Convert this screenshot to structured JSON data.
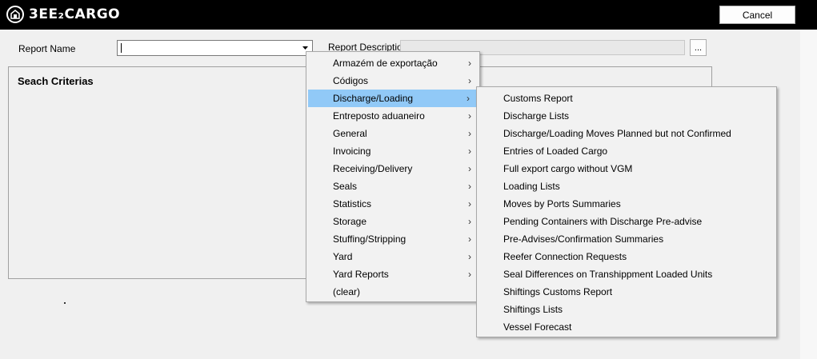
{
  "app": {
    "logo_text": "3EE₂CARGO"
  },
  "header": {
    "cancel_label": "Cancel"
  },
  "form": {
    "report_name_label": "Report Name",
    "report_name_value": "",
    "report_description_label": "Report Description",
    "ellipsis_label": "...",
    "search_criteria_title": "Seach Criterias"
  },
  "menu": {
    "items": [
      {
        "label": "Armazém de exportação",
        "has_sub": true,
        "selected": false
      },
      {
        "label": "Códigos",
        "has_sub": true,
        "selected": false
      },
      {
        "label": "Discharge/Loading",
        "has_sub": true,
        "selected": true
      },
      {
        "label": "Entreposto aduaneiro",
        "has_sub": true,
        "selected": false
      },
      {
        "label": "General",
        "has_sub": true,
        "selected": false
      },
      {
        "label": "Invoicing",
        "has_sub": true,
        "selected": false
      },
      {
        "label": "Receiving/Delivery",
        "has_sub": true,
        "selected": false
      },
      {
        "label": "Seals",
        "has_sub": true,
        "selected": false
      },
      {
        "label": "Statistics",
        "has_sub": true,
        "selected": false
      },
      {
        "label": "Storage",
        "has_sub": true,
        "selected": false
      },
      {
        "label": "Stuffing/Stripping",
        "has_sub": true,
        "selected": false
      },
      {
        "label": "Yard",
        "has_sub": true,
        "selected": false
      },
      {
        "label": "Yard Reports",
        "has_sub": true,
        "selected": false
      },
      {
        "label": "(clear)",
        "has_sub": false,
        "selected": false
      }
    ],
    "submenu": [
      "Customs Report",
      "Discharge Lists",
      "Discharge/Loading Moves Planned but not Confirmed",
      "Entries of Loaded Cargo",
      "Full export cargo without VGM",
      "Loading Lists",
      "Moves by Ports Summaries",
      "Pending Containers with Discharge Pre-advise",
      "Pre-Advises/Confirmation Summaries",
      "Reefer Connection Requests",
      "Seal Differences on Transhippment Loaded Units",
      "Shiftings Customs Report",
      "Shiftings Lists",
      "Vessel Forecast"
    ]
  },
  "colors": {
    "selection": "#91c9f7",
    "topbar": "#000000"
  }
}
